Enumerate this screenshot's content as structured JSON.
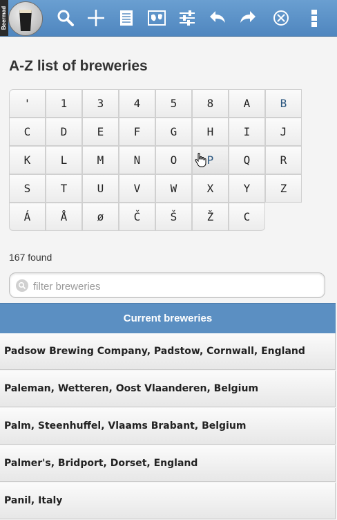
{
  "app": {
    "brand_label": "Beermad"
  },
  "toolbar": {
    "icons": [
      "search-icon",
      "add-icon",
      "list-icon",
      "map-icon",
      "settings-sliders-icon",
      "back-icon",
      "forward-icon",
      "close-icon",
      "menu-icon"
    ]
  },
  "page": {
    "title": "A-Z list of breweries"
  },
  "letters": [
    "'",
    "1",
    "3",
    "4",
    "5",
    "8",
    "A",
    "B",
    "C",
    "D",
    "E",
    "F",
    "G",
    "H",
    "I",
    "J",
    "K",
    "L",
    "M",
    "N",
    "O",
    "P",
    "Q",
    "R",
    "S",
    "T",
    "U",
    "V",
    "W",
    "X",
    "Y",
    "Z",
    "Á",
    "Å",
    "ø",
    "Č",
    "Š",
    "Ž",
    "C"
  ],
  "results": {
    "found_text": "167 found"
  },
  "filter": {
    "placeholder": "filter breweries",
    "value": ""
  },
  "list": {
    "header": "Current breweries",
    "items": [
      "Padsow Brewing Company, Padstow, Cornwall, England",
      "Paleman, Wetteren, Oost Vlaanderen, Belgium",
      "Palm, Steenhuffel, Vlaams Brabant, Belgium",
      "Palmer's, Bridport, Dorset, England",
      "Panil, Italy"
    ]
  }
}
